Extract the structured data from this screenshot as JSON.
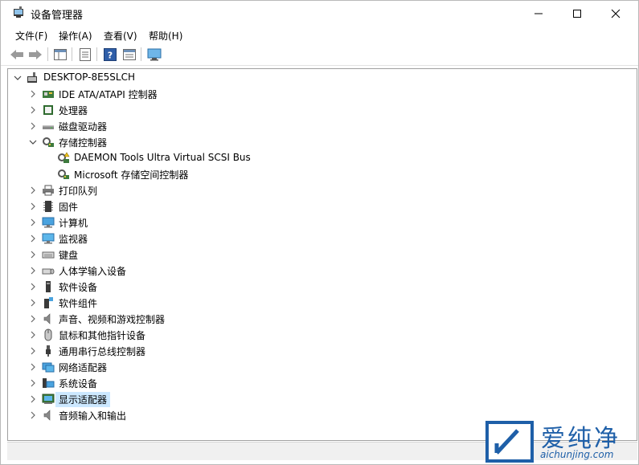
{
  "window": {
    "title": "设备管理器"
  },
  "menu": {
    "file": "文件(F)",
    "action": "操作(A)",
    "view": "查看(V)",
    "help": "帮助(H)"
  },
  "tree": {
    "root": "DESKTOP-8E5SLCH",
    "items": [
      {
        "label": "IDE ATA/ATAPI 控制器"
      },
      {
        "label": "处理器"
      },
      {
        "label": "磁盘驱动器"
      },
      {
        "label": "存储控制器",
        "children": [
          {
            "label": "DAEMON Tools Ultra Virtual SCSI Bus"
          },
          {
            "label": "Microsoft 存储空间控制器"
          }
        ]
      },
      {
        "label": "打印队列"
      },
      {
        "label": "固件"
      },
      {
        "label": "计算机"
      },
      {
        "label": "监视器"
      },
      {
        "label": "键盘"
      },
      {
        "label": "人体学输入设备"
      },
      {
        "label": "软件设备"
      },
      {
        "label": "软件组件"
      },
      {
        "label": "声音、视频和游戏控制器"
      },
      {
        "label": "鼠标和其他指针设备"
      },
      {
        "label": "通用串行总线控制器"
      },
      {
        "label": "网络适配器"
      },
      {
        "label": "系统设备"
      },
      {
        "label": "显示适配器"
      },
      {
        "label": "音频输入和输出"
      }
    ]
  },
  "watermark": {
    "title": "爱纯净",
    "url": "aichunjing.com"
  },
  "colors": {
    "selection": "#cce8ff",
    "watermark": "#1e5fa8"
  }
}
